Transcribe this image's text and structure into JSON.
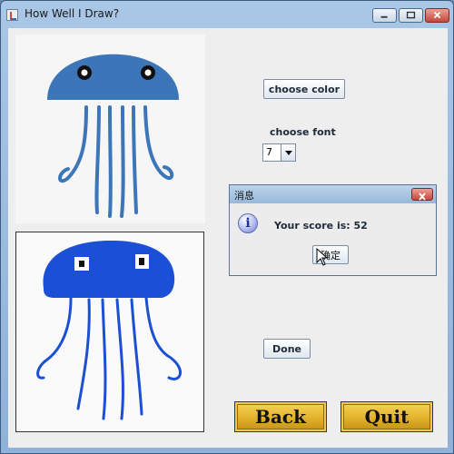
{
  "window": {
    "title": "How Well I Draw?"
  },
  "controls": {
    "choose_color_label": "choose color",
    "choose_font_label": "choose font",
    "font_size_value": "7",
    "done_label": "Done",
    "back_label": "Back",
    "quit_label": "Quit"
  },
  "dialog": {
    "title": "消息",
    "message": "Your score is: 52",
    "ok_label": "确定",
    "icon": "info-icon"
  },
  "colors": {
    "reference_blue": "#3d76b8",
    "drawing_blue": "#1a4fd6",
    "gold_button": "#e2b22b"
  }
}
